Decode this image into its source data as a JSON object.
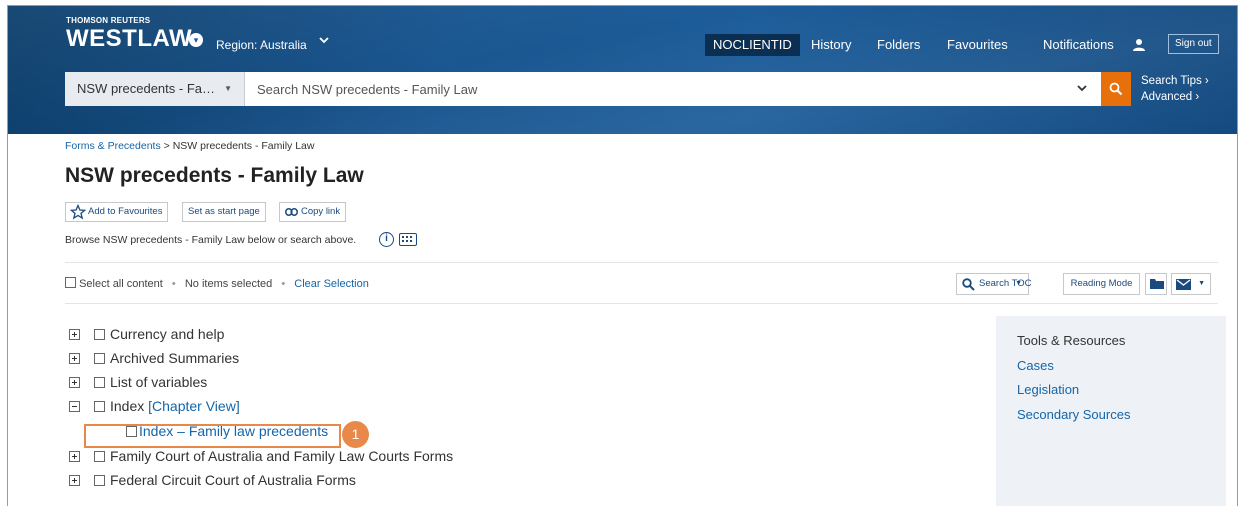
{
  "header": {
    "brand_top": "THOMSON REUTERS",
    "brand_main": "WESTLAW",
    "brand_dot_icon": "chevron-down-icon",
    "region": "Region: Australia",
    "client_id": "NOCLIENTID",
    "nav": {
      "history": "History",
      "folders": "Folders",
      "favourites": "Favourites",
      "notifications": "Notifications"
    },
    "sign_out": "Sign out"
  },
  "search": {
    "scope": "NSW precedents - Fa…",
    "placeholder": "Search NSW precedents - Family Law",
    "tips": "Search Tips ›",
    "advanced": "Advanced ›",
    "button_color": "#e8700a"
  },
  "breadcrumb": {
    "link": "Forms & Precedents",
    "separator": ">",
    "current": "NSW precedents - Family Law"
  },
  "page": {
    "title": "NSW precedents - Family Law",
    "add_favourites": "Add to Favourites",
    "set_start": "Set as start page",
    "copy_link": "Copy link",
    "browse_text": "Browse NSW precedents - Family Law below or search above.",
    "info_icon_text": "i"
  },
  "selection": {
    "select_all": "Select all content",
    "bullet": "•",
    "status": "No items selected",
    "clear": "Clear Selection"
  },
  "toolbar": {
    "search_toc": "Search TOC",
    "reading_mode": "Reading Mode"
  },
  "toc": {
    "items": [
      {
        "label": "Currency and help"
      },
      {
        "label": "Archived Summaries"
      },
      {
        "label": "List of variables"
      },
      {
        "label": "Index",
        "link": "[Chapter View]"
      },
      {
        "label": "Index – Family law precedents"
      },
      {
        "label": "Family Court of Australia and Family Law Courts Forms"
      },
      {
        "label": "Federal Circuit Court of Australia Forms"
      }
    ]
  },
  "callout": {
    "number": "1",
    "color": "#e8894a"
  },
  "tools": {
    "title": "Tools & Resources",
    "links": [
      "Cases",
      "Legislation",
      "Secondary Sources"
    ]
  }
}
